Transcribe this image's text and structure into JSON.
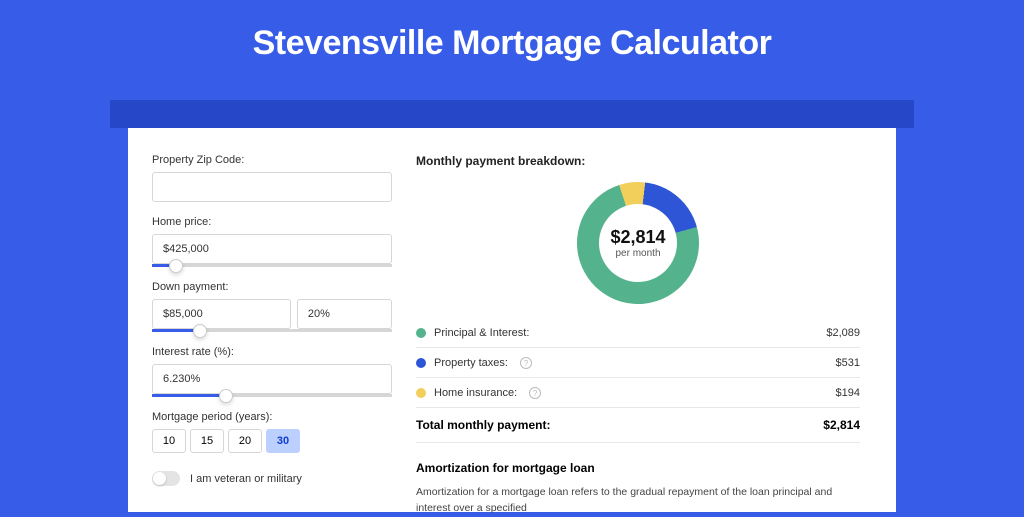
{
  "title": "Stevensville Mortgage Calculator",
  "form": {
    "zip_label": "Property Zip Code:",
    "zip_value": "",
    "home_price_label": "Home price:",
    "home_price_value": "$425,000",
    "home_price_slider_pct": 10,
    "down_label": "Down payment:",
    "down_value": "$85,000",
    "down_pct_value": "20%",
    "down_slider_pct": 20,
    "rate_label": "Interest rate (%):",
    "rate_value": "6.230%",
    "rate_slider_pct": 31,
    "period_label": "Mortgage period (years):",
    "periods": [
      "10",
      "15",
      "20",
      "30"
    ],
    "period_selected_index": 3,
    "veteran_label": "I am veteran or military"
  },
  "breakdown": {
    "title": "Monthly payment breakdown:",
    "total_display": "$2,814",
    "per_month_label": "per month",
    "items": [
      {
        "label": "Principal & Interest:",
        "value": "$2,089",
        "color": "#54b28d",
        "has_info": false
      },
      {
        "label": "Property taxes:",
        "value": "$531",
        "color": "#2e55d6",
        "has_info": true
      },
      {
        "label": "Home insurance:",
        "value": "$194",
        "color": "#f2cf5b",
        "has_info": true
      }
    ],
    "total_label": "Total monthly payment:",
    "total_value": "$2,814"
  },
  "chart_data": {
    "type": "pie",
    "title": "Monthly payment breakdown",
    "series": [
      {
        "name": "Principal & Interest",
        "value": 2089,
        "color": "#54b28d"
      },
      {
        "name": "Property taxes",
        "value": 531,
        "color": "#2e55d6"
      },
      {
        "name": "Home insurance",
        "value": 194,
        "color": "#f2cf5b"
      }
    ],
    "total": 2814,
    "center_label": "$2,814",
    "center_sub": "per month"
  },
  "amortization": {
    "title": "Amortization for mortgage loan",
    "body": "Amortization for a mortgage loan refers to the gradual repayment of the loan principal and interest over a specified"
  }
}
